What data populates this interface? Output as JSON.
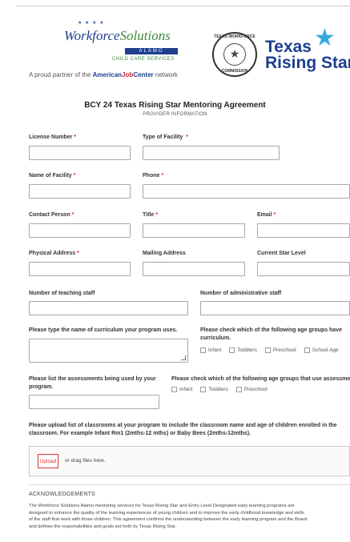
{
  "header": {
    "wfs_logo": {
      "title_a": "Workforce",
      "title_b": "Solutions",
      "bar": "ALAMO",
      "sub": "CHILD CARE SERVICES"
    },
    "partner_text": {
      "prefix": "A proud partner of the ",
      "ajc_a": "American",
      "ajc_b": "Job",
      "ajc_c": "Center",
      "suffix": " network"
    },
    "seal": {
      "top": "TEXAS WORKFORCE",
      "bottom": "COMMISSION"
    },
    "trs_logo": {
      "line1": "Texas",
      "line2": "Rising Star"
    }
  },
  "form": {
    "title": "BCY 24 Texas Rising Star Mentoring Agreement",
    "subtitle": "PROVIDER INFORMATION",
    "fields": {
      "license_number": "License Number",
      "type_of_facility": "Type of Facility",
      "name_of_facility": "Name of Facility",
      "phone": "Phone",
      "contact_person": "Contact Person",
      "title": "Title",
      "email": "Email",
      "physical_address": "Physical Address",
      "mailing_address": "Mailing Address",
      "current_star_level": "Current Star Level",
      "teaching_staff": "Number of teaching staff",
      "admin_staff": "Number of administrative staff",
      "curriculum": "Please type the name of curriculum your program uses.",
      "curriculum_ages": "Please check which of the following age groups have curriculum.",
      "assessments": "Please list the assessments being used by your program.",
      "assessment_ages": "Please check which of the following age groups that use assessments."
    },
    "required_mark": "*",
    "curriculum_options": [
      "Infant",
      "Toddlers",
      "Preschool",
      "School Age"
    ],
    "assessment_options": [
      "Infant",
      "Toddlers",
      "Preschool"
    ],
    "upload": {
      "instructions": "Please upload list of classrooms at your program to include the classroom name and age of children enrolled in the classroom. For example Infant Rm1 (2mths-12 mths) or Baby Bees (2mths-12mths).",
      "button": "Upload",
      "drag_text": "or drag files here."
    },
    "acknowledgements": {
      "title": "ACKNOWLEDGEMENTS",
      "text": "The Workforce Solutions Alamo mentoring services for Texas Rising Star and Entry Level Designated early learning programs are\ndesigned to enhance the quality of the learning experiences of young children and to improve the early childhood knowledge and skills\nof the staff that work with those children. This agreement confirms the understanding between the early learning program and the Board\nand defines the responsibilities and goals set forth by Texas Rising Star."
    }
  },
  "colors": {
    "brand_blue": "#1d3f8f",
    "brand_green": "#3d8b3a",
    "star_blue": "#36a9e0",
    "required_red": "#d22222"
  }
}
